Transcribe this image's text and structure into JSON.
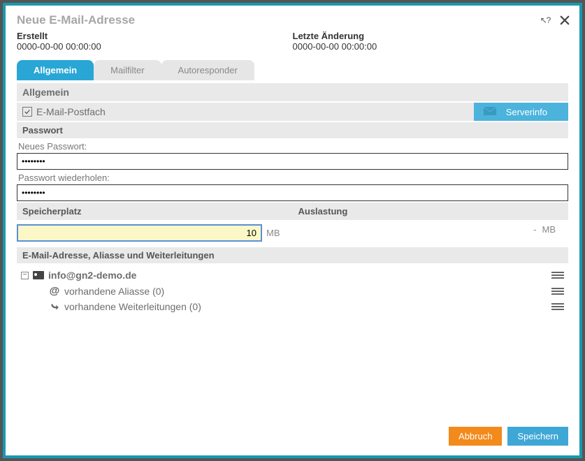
{
  "title": "Neue E-Mail-Adresse",
  "meta": {
    "created_label": "Erstellt",
    "created_value": "0000-00-00 00:00:00",
    "modified_label": "Letzte Änderung",
    "modified_value": "0000-00-00 00:00:00"
  },
  "tabs": {
    "general": "Allgemein",
    "mailfilter": "Mailfilter",
    "autoresponder": "Autoresponder"
  },
  "section": {
    "general_header": "Allgemein",
    "mailbox_label": "E-Mail-Postfach",
    "serverinfo": "Serverinfo",
    "password_header": "Passwort",
    "new_password_label": "Neues Passwort:",
    "new_password_value": "••••••••",
    "repeat_password_label": "Passwort wiederholen:",
    "repeat_password_value": "••••••••",
    "storage_header": "Speicherplatz",
    "storage_value": "10",
    "storage_unit": "MB",
    "usage_header": "Auslastung",
    "usage_value": "-",
    "usage_unit": "MB",
    "aliases_header": "E-Mail-Adresse, Aliasse und Weiterleitungen"
  },
  "tree": {
    "email": "info@gn2-demo.de",
    "aliases": "vorhandene Aliasse (0)",
    "forwards": "vorhandene Weiterleitungen (0)"
  },
  "footer": {
    "cancel": "Abbruch",
    "save": "Speichern"
  }
}
